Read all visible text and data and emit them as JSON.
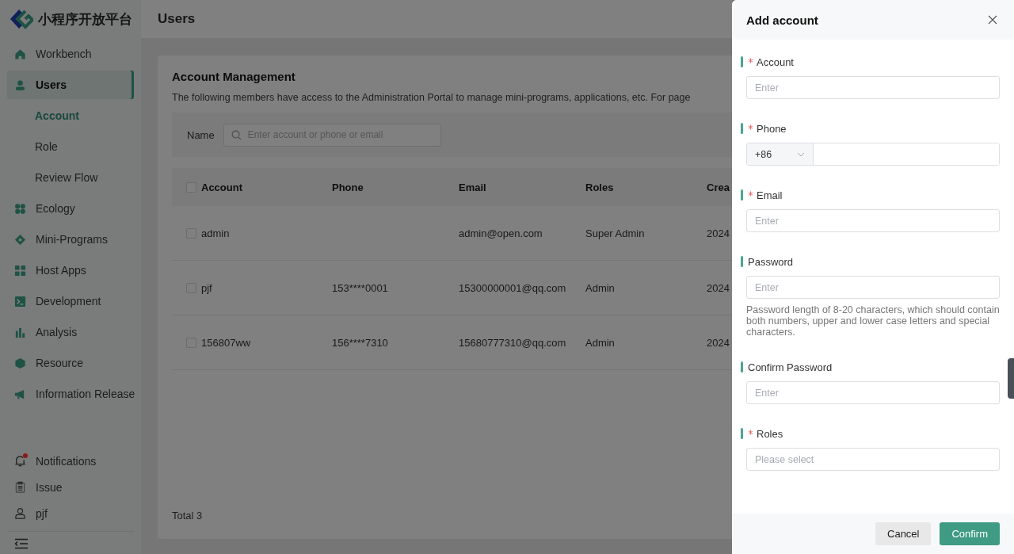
{
  "brand": {
    "name": "小程序开放平台"
  },
  "header": {
    "title": "Users"
  },
  "sidebar": {
    "items": [
      {
        "label": "Workbench",
        "selected": false
      },
      {
        "label": "Users",
        "selected": true,
        "children": [
          {
            "label": "Account",
            "selected": true
          },
          {
            "label": "Role",
            "selected": false
          },
          {
            "label": "Review Flow",
            "selected": false
          }
        ]
      },
      {
        "label": "Ecology",
        "selected": false
      },
      {
        "label": "Mini-Programs",
        "selected": false
      },
      {
        "label": "Host Apps",
        "selected": false
      },
      {
        "label": "Development",
        "selected": false
      },
      {
        "label": "Analysis",
        "selected": false
      },
      {
        "label": "Resource",
        "selected": false
      },
      {
        "label": "Information Release",
        "selected": false
      }
    ],
    "bottom": [
      {
        "label": "Notifications",
        "badge": true
      },
      {
        "label": "Issue",
        "badge": false
      },
      {
        "label": "pjf",
        "badge": false
      }
    ]
  },
  "page": {
    "title": "Account Management",
    "description": "The following members have access to the Administration Portal to manage mini-programs, applications, etc. For page",
    "filter": {
      "label": "Name",
      "placeholder": "Enter account or phone or email"
    },
    "table": {
      "select_all": {
        "checked": false
      },
      "columns": [
        "Account",
        "Phone",
        "Email",
        "Roles",
        "Crea"
      ],
      "rows": [
        {
          "checked": false,
          "cells": [
            "admin",
            "",
            "admin@open.com",
            "Super Admin",
            "2024"
          ]
        },
        {
          "checked": false,
          "cells": [
            "pjf",
            "153****0001",
            "15300000001@qq.com",
            "Admin",
            "2024"
          ]
        },
        {
          "checked": false,
          "cells": [
            "156807ww",
            "156****7310",
            "15680777310@qq.com",
            "Admin",
            "2024"
          ]
        }
      ]
    },
    "total": "Total 3"
  },
  "drawer": {
    "title": "Add account",
    "fields": [
      {
        "kind": "text",
        "label": "Account",
        "required": true,
        "placeholder": "Enter"
      },
      {
        "kind": "phone",
        "label": "Phone",
        "required": true,
        "prefix": "+86"
      },
      {
        "kind": "text",
        "label": "Email",
        "required": true,
        "placeholder": "Enter"
      },
      {
        "kind": "text",
        "label": "Password",
        "required": false,
        "placeholder": "Enter",
        "hint": "Password length of 8-20 characters, which should contain both numbers, upper and lower case letters and special characters."
      },
      {
        "kind": "text",
        "label": "Confirm Password",
        "required": false,
        "placeholder": "Enter"
      },
      {
        "kind": "select",
        "label": "Roles",
        "required": true,
        "placeholder": "Please select"
      }
    ],
    "buttons": [
      {
        "label": "Cancel",
        "primary": false
      },
      {
        "label": "Confirm",
        "primary": true
      }
    ]
  }
}
